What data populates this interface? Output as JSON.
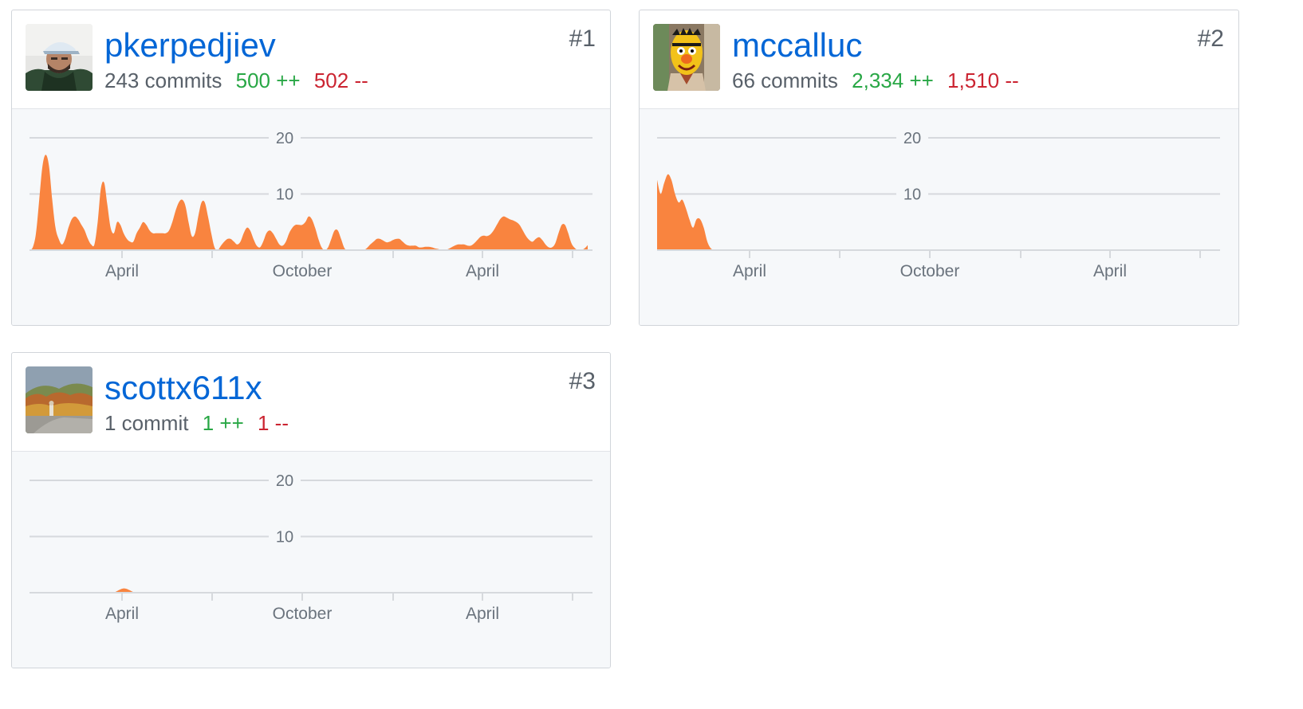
{
  "contributors": [
    {
      "username": "pkerpedjiev",
      "rank": "#1",
      "commits": "243 commits",
      "additions": "500 ++",
      "deletions": "502 --",
      "avatar": "man-in-cap-photo"
    },
    {
      "username": "mccalluc",
      "rank": "#2",
      "commits": "66 commits",
      "additions": "2,334 ++",
      "deletions": "1,510 --",
      "avatar": "yellow-puppet-photo"
    },
    {
      "username": "scottx611x",
      "rank": "#3",
      "commits": "1 commit",
      "additions": "1 ++",
      "deletions": "1 --",
      "avatar": "hiker-autumn-photo"
    }
  ],
  "colors": {
    "link": "#0366d6",
    "additions": "#28a745",
    "deletions": "#cb2431",
    "area_fill": "#f9843f",
    "muted": "#586069"
  },
  "chart_data": [
    {
      "type": "area",
      "yticks": [
        10,
        20
      ],
      "ylim": [
        0,
        20
      ],
      "xticks": [
        "April",
        "October",
        "April"
      ],
      "grid": true,
      "series": [
        {
          "values": [
            0,
            0.5,
            3,
            9,
            15,
            17,
            15,
            9,
            4,
            2,
            1,
            2,
            4,
            5.5,
            6,
            5.5,
            4.5,
            3.5,
            2,
            1,
            1,
            5,
            11,
            12,
            8,
            4,
            3,
            5,
            4.5,
            3,
            2,
            1.5,
            1.5,
            3,
            4,
            5,
            4.5,
            3.5,
            3,
            3,
            3,
            3,
            3,
            3.5,
            5,
            7,
            8.5,
            9,
            8,
            5,
            2.5,
            3,
            6,
            8.5,
            8.5,
            6,
            3,
            0.5,
            0,
            0.8,
            1.5,
            2,
            2,
            1.5,
            1,
            1.5,
            3,
            4,
            3.5,
            2,
            0.8,
            0.5,
            1.5,
            3,
            3.5,
            3,
            2,
            1,
            0.8,
            1.5,
            3,
            4,
            4.5,
            4.5,
            4.5,
            5,
            6,
            5.5,
            4,
            2,
            0.5,
            0,
            0.5,
            2,
            3.5,
            3.5,
            2,
            0.4,
            0,
            0,
            0,
            0,
            0,
            0,
            0.4,
            1,
            1.5,
            2,
            2,
            1.7,
            1.4,
            1.5,
            1.8,
            2,
            2,
            1.5,
            1,
            0.8,
            0.8,
            0.8,
            0.5,
            0.5,
            0.6,
            0.6,
            0.5,
            0.3,
            0.2,
            0,
            0,
            0.2,
            0.5,
            0.8,
            1,
            1,
            1,
            0.8,
            0.8,
            1.2,
            1.8,
            2.4,
            2.6,
            2.5,
            2.8,
            3.5,
            4.5,
            5.5,
            6,
            5.8,
            5.5,
            5.3,
            5,
            4.5,
            3.5,
            2.5,
            1.8,
            1.5,
            2,
            2.3,
            1.8,
            1,
            0.5,
            0.5,
            1.2,
            3,
            4.5,
            4.5,
            3,
            1.2,
            0.4,
            0,
            0,
            0.3,
            0.9
          ]
        }
      ]
    },
    {
      "type": "area",
      "yticks": [
        10,
        20
      ],
      "ylim": [
        0,
        20
      ],
      "xticks": [
        "April",
        "October",
        "April"
      ],
      "grid": true,
      "series": [
        {
          "values": [
            12.5,
            10,
            12,
            13.5,
            12.5,
            10,
            8.5,
            9,
            7.5,
            5.5,
            4,
            5.5,
            5.5,
            4,
            1.5,
            0.3,
            0
          ]
        }
      ]
    },
    {
      "type": "area",
      "yticks": [
        10,
        20
      ],
      "ylim": [
        0,
        20
      ],
      "xticks": [
        "April",
        "October",
        "April"
      ],
      "grid": true,
      "series": [
        {
          "values": [
            0,
            0,
            0,
            0,
            0,
            0,
            0,
            0,
            0,
            0,
            0,
            0,
            0,
            0,
            0,
            0,
            0,
            0,
            0,
            0,
            0,
            0,
            0,
            0,
            0,
            0,
            0,
            0.25,
            0.55,
            0.75,
            0.7,
            0.45,
            0.15,
            0,
            0,
            0,
            0,
            0,
            0,
            0,
            0,
            0,
            0,
            0,
            0,
            0,
            0,
            0,
            0,
            0,
            0,
            0,
            0,
            0,
            0,
            0,
            0,
            0,
            0,
            0,
            0,
            0,
            0,
            0,
            0,
            0,
            0,
            0,
            0,
            0,
            0,
            0,
            0,
            0,
            0,
            0,
            0,
            0,
            0,
            0,
            0,
            0,
            0,
            0,
            0,
            0,
            0,
            0,
            0,
            0,
            0,
            0,
            0,
            0,
            0,
            0,
            0,
            0,
            0,
            0,
            0,
            0,
            0,
            0,
            0,
            0,
            0,
            0,
            0,
            0,
            0,
            0,
            0,
            0,
            0,
            0,
            0,
            0,
            0,
            0,
            0,
            0,
            0,
            0,
            0,
            0,
            0,
            0,
            0,
            0,
            0,
            0,
            0,
            0,
            0,
            0,
            0,
            0,
            0,
            0,
            0,
            0,
            0,
            0,
            0,
            0,
            0,
            0,
            0,
            0,
            0,
            0,
            0,
            0,
            0,
            0,
            0,
            0,
            0,
            0,
            0,
            0,
            0,
            0,
            0,
            0,
            0,
            0,
            0,
            0,
            0,
            0,
            0,
            0
          ]
        }
      ]
    }
  ]
}
